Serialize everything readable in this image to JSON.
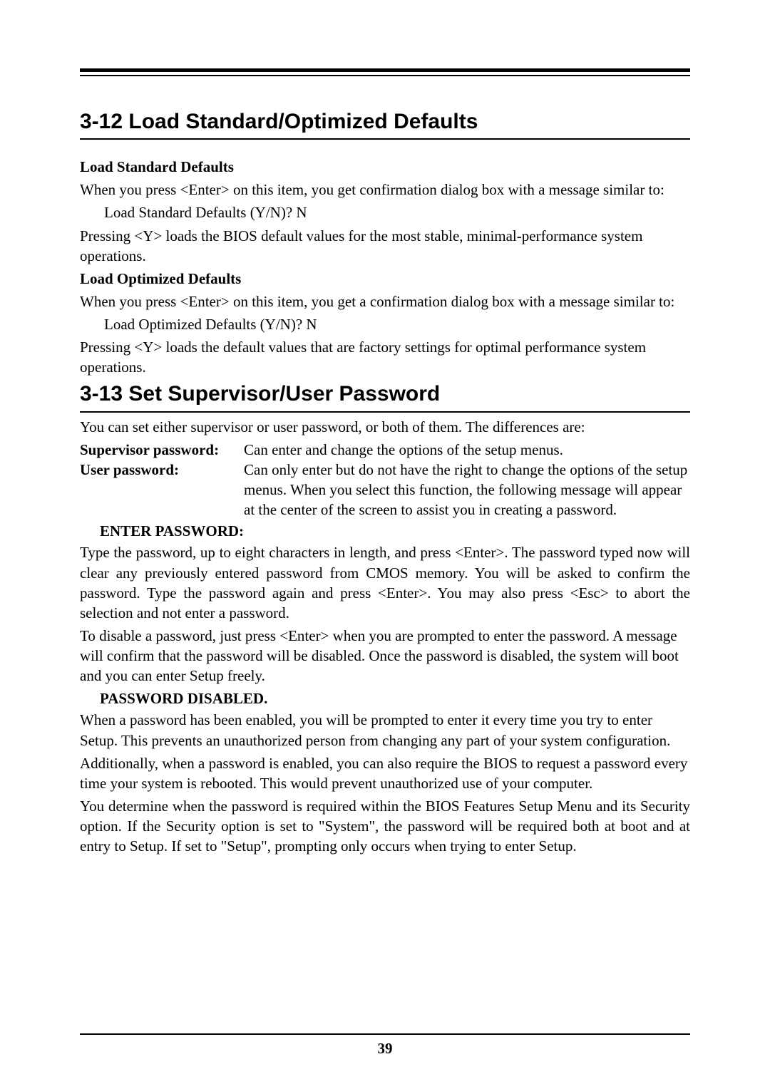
{
  "sections": {
    "s312": {
      "num": "3-12",
      "title": "Load Standard/Optimized Defaults",
      "h1": "Load Standard Defaults",
      "p1": "When you press <Enter> on this item, you get confirmation dialog box with a message similar to:",
      "q1": "Load Standard Defaults (Y/N)? N",
      "p2": "Pressing <Y> loads the BIOS default values for the most stable, minimal-performance system operations.",
      "h2": "Load Optimized Defaults",
      "p3": "When you press <Enter> on this item, you get a confirmation dialog box with a message similar to:",
      "q2": "Load Optimized Defaults (Y/N)? N",
      "p4": "Pressing <Y> loads the default values that are factory settings for optimal performance system operations."
    },
    "s313": {
      "num": "3-13",
      "title": "Set Supervisor/User Password",
      "intro": "You can set either supervisor or user password, or both of them.    The differences are:",
      "suplabel": "Supervisor password:",
      "suptext": "Can enter and change the options of the setup menus.",
      "userlabel": "User password:",
      "usertext": "Can only enter but do not have the right to change the options of the setup menus.    When you select this function, the following message will appear at the center of the screen to assist you in creating a password.",
      "enter": "ENTER PASSWORD:",
      "p1": "Type the password, up to eight characters in length, and press <Enter>.    The password typed now will clear any previously entered password from CMOS memory.    You will be asked to confirm the password.    Type the password again and press <Enter>.    You may also press <Esc> to abort the selection and not enter a password.",
      "p2": "To disable a password, just press <Enter> when you are prompted to enter the password.    A message will confirm that the password will be disabled.    Once the password is disabled, the system will boot and you can enter Setup freely.",
      "disabled": "PASSWORD DISABLED.",
      "p3": "When a password has been enabled, you will be prompted to enter it every time you try to enter Setup.    This prevents an unauthorized person from changing any part of your system configuration.",
      "p4": "Additionally, when a password is enabled, you can also require the BIOS to request a password every time your system is rebooted.    This would prevent unauthorized use of your computer.",
      "p5": "You determine when the password is required within the BIOS Features Setup Menu and its Security option.    If the Security option is set to \"System\", the password will be required both at boot and at entry to Setup.    If set to \"Setup\", prompting only occurs when trying to enter Setup."
    }
  },
  "page_number": "39"
}
